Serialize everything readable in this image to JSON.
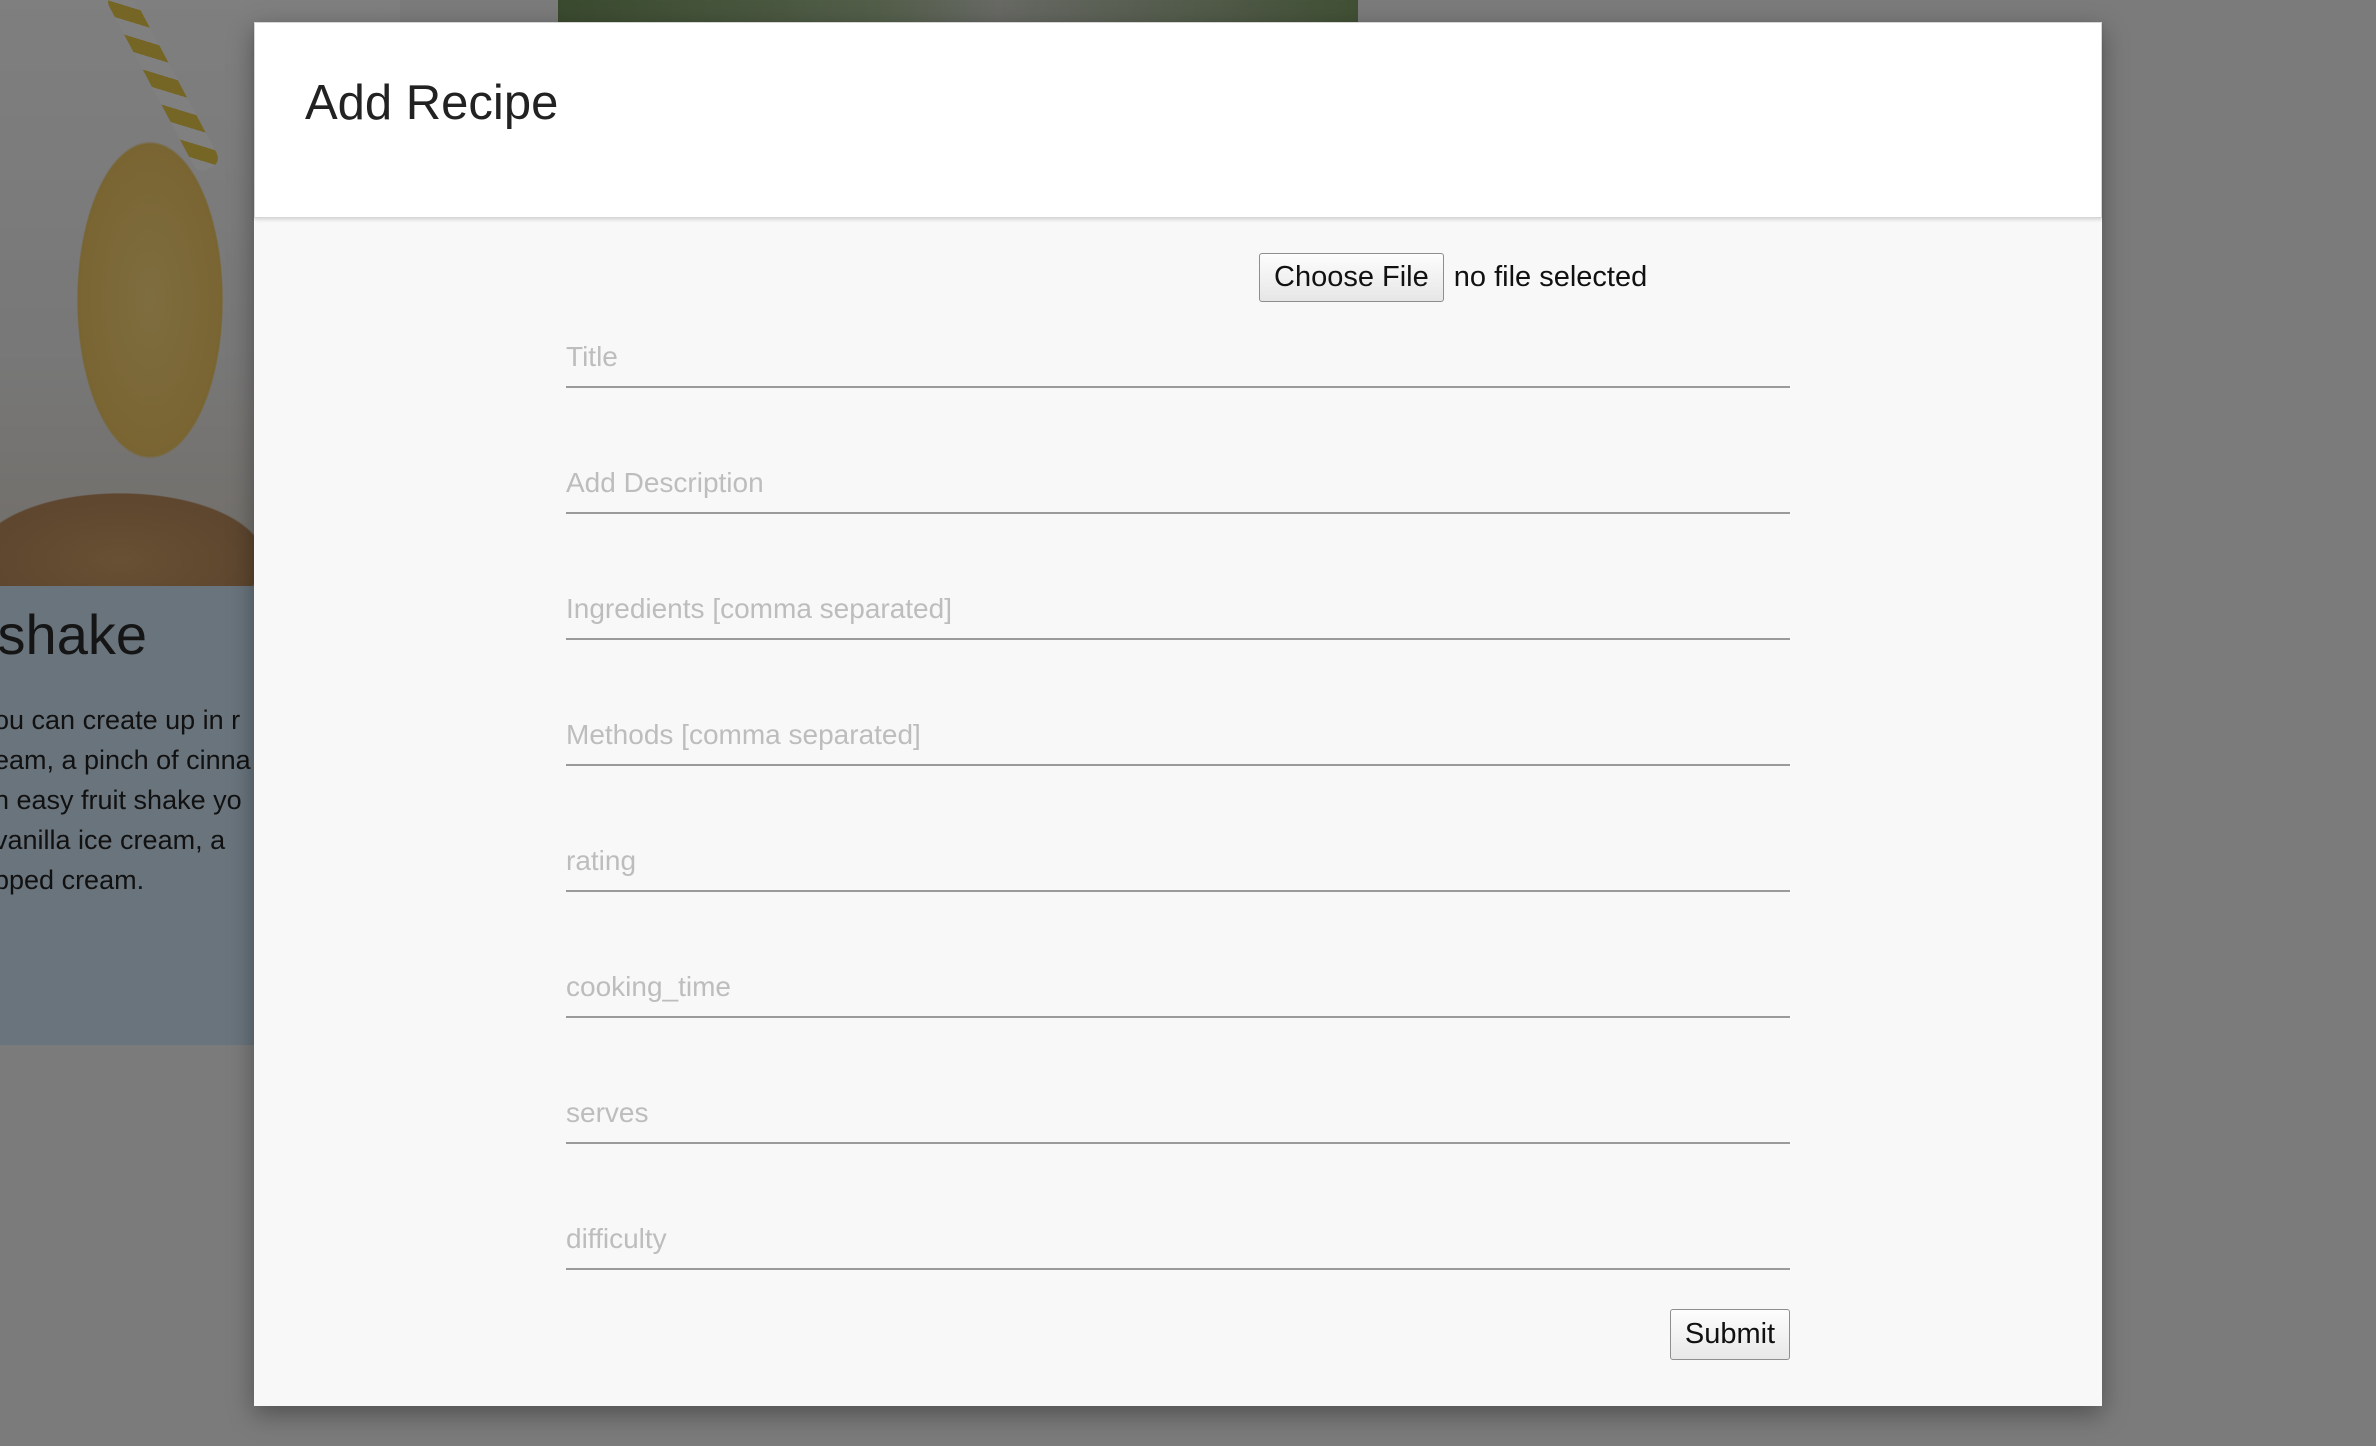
{
  "background": {
    "card": {
      "title": "tshake",
      "description": "ou can create up in r\neam, a pinch of cinna\nn easy fruit shake yo\n vanilla ice cream, a\npped cream."
    }
  },
  "modal": {
    "title": "Add Recipe",
    "file_input": {
      "button_label": "Choose File",
      "status": "no file selected"
    },
    "fields": {
      "title": {
        "placeholder": "Title",
        "value": ""
      },
      "description": {
        "placeholder": "Add Description",
        "value": ""
      },
      "ingredients": {
        "placeholder": "Ingredients [comma separated]",
        "value": ""
      },
      "methods": {
        "placeholder": "Methods [comma separated]",
        "value": ""
      },
      "rating": {
        "placeholder": "rating",
        "value": ""
      },
      "cooking_time": {
        "placeholder": "cooking_time",
        "value": ""
      },
      "serves": {
        "placeholder": "serves",
        "value": ""
      },
      "difficulty": {
        "placeholder": "difficulty",
        "value": ""
      }
    },
    "submit_label": "Submit"
  },
  "colors": {
    "overlay": "#000000",
    "modal_body": "#f8f8f8",
    "modal_header": "#ffffff",
    "placeholder": "#bdbdbd",
    "underline": "#9a9a9a"
  }
}
